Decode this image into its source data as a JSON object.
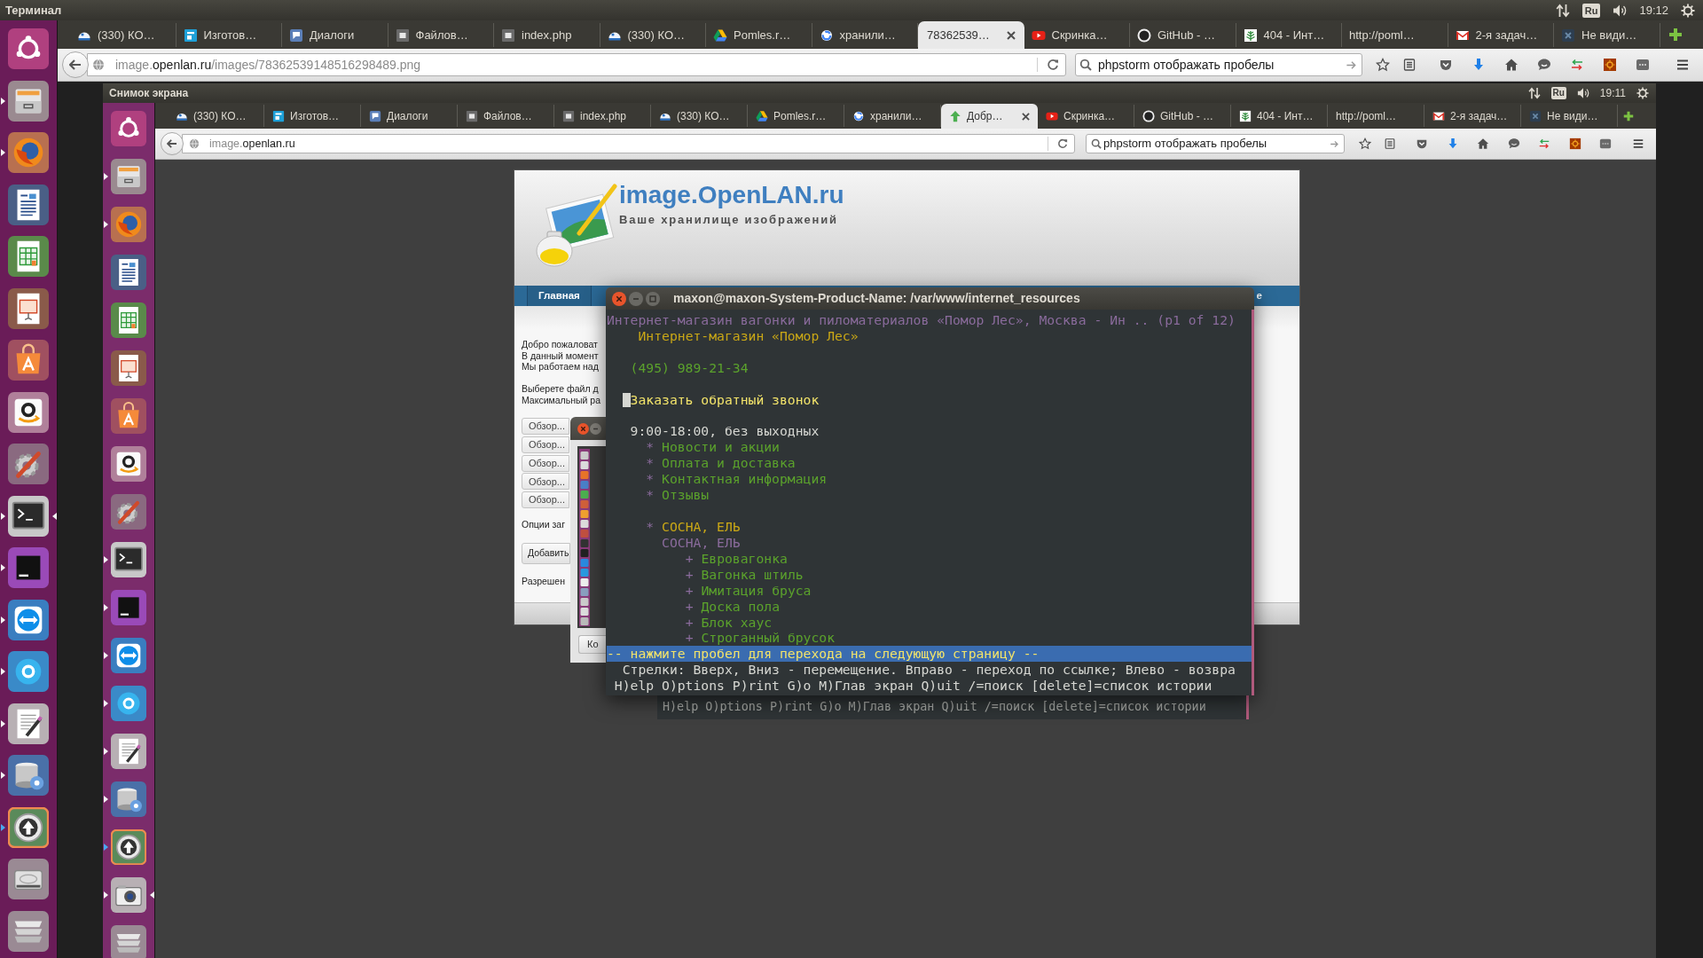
{
  "top_panel": {
    "title": "Терминал",
    "keyboard_layout": "Ru",
    "time": "19:12"
  },
  "launcher": {
    "items": [
      {
        "running": false,
        "focused": false,
        "urgent": false
      },
      {
        "running": true,
        "focused": false,
        "urgent": false
      },
      {
        "running": true,
        "focused": false,
        "urgent": false
      },
      {
        "running": false,
        "focused": false,
        "urgent": false
      },
      {
        "running": false,
        "focused": false,
        "urgent": false
      },
      {
        "running": false,
        "focused": false,
        "urgent": false
      },
      {
        "running": false,
        "focused": false,
        "urgent": false
      },
      {
        "running": false,
        "focused": false,
        "urgent": false
      },
      {
        "running": false,
        "focused": false,
        "urgent": false
      },
      {
        "running": true,
        "focused": true,
        "urgent": false
      },
      {
        "running": true,
        "focused": false,
        "urgent": false
      },
      {
        "running": true,
        "focused": false,
        "urgent": false
      },
      {
        "running": true,
        "focused": false,
        "urgent": false
      },
      {
        "running": true,
        "focused": false,
        "urgent": false
      },
      {
        "running": true,
        "focused": false,
        "urgent": false
      },
      {
        "running": true,
        "focused": false,
        "urgent": true
      },
      {
        "running": false,
        "focused": false,
        "urgent": false
      },
      {
        "running": false,
        "focused": false,
        "urgent": false
      }
    ]
  },
  "browser": {
    "tabs": [
      {
        "title": "(330) КО…",
        "selected": false
      },
      {
        "title": "Изготов…",
        "selected": false
      },
      {
        "title": "Диалоги",
        "selected": false
      },
      {
        "title": "Файлов…",
        "selected": false
      },
      {
        "title": "index.php",
        "selected": false
      },
      {
        "title": "(330) КО…",
        "selected": false
      },
      {
        "title": "Pomles.r…",
        "selected": false
      },
      {
        "title": "хранили…",
        "selected": false
      },
      {
        "title": "78362539…",
        "selected": true
      },
      {
        "title": "Скринка…",
        "selected": false
      },
      {
        "title": "GitHub - …",
        "selected": false
      },
      {
        "title": "404 - Инт…",
        "selected": false
      },
      {
        "title": "http://poml…",
        "selected": false
      },
      {
        "title": "2-я задач…",
        "selected": false
      },
      {
        "title": "Не види…",
        "selected": false
      }
    ],
    "address": {
      "host_start": "image.",
      "domain": "openlan.ru",
      "path": "/images/78362539148516298489.png"
    },
    "search": {
      "value": "phpstorm отображать пробелы"
    }
  },
  "screenshot": {
    "top_panel": {
      "title": "Снимок экрана",
      "keyboard_layout": "Ru",
      "time": "19:11"
    },
    "launcher": {
      "items": [
        {
          "running": false,
          "focused": false,
          "urgent": false
        },
        {
          "running": true,
          "focused": false,
          "urgent": false
        },
        {
          "running": true,
          "focused": false,
          "urgent": false
        },
        {
          "running": false,
          "focused": false,
          "urgent": false
        },
        {
          "running": false,
          "focused": false,
          "urgent": false
        },
        {
          "running": false,
          "focused": false,
          "urgent": false
        },
        {
          "running": false,
          "focused": false,
          "urgent": false
        },
        {
          "running": false,
          "focused": false,
          "urgent": false
        },
        {
          "running": false,
          "focused": false,
          "urgent": false
        },
        {
          "running": true,
          "focused": false,
          "urgent": false
        },
        {
          "running": true,
          "focused": false,
          "urgent": false
        },
        {
          "running": true,
          "focused": false,
          "urgent": false
        },
        {
          "running": true,
          "focused": false,
          "urgent": false
        },
        {
          "running": true,
          "focused": false,
          "urgent": false
        },
        {
          "running": true,
          "focused": false,
          "urgent": false
        },
        {
          "running": true,
          "focused": false,
          "urgent": true
        },
        {
          "running": true,
          "focused": true,
          "urgent": false
        },
        {
          "running": false,
          "focused": false,
          "urgent": false
        }
      ]
    },
    "browser": {
      "tabs": [
        {
          "title": "(330) КО…",
          "selected": false
        },
        {
          "title": "Изготов…",
          "selected": false
        },
        {
          "title": "Диалоги",
          "selected": false
        },
        {
          "title": "Файлов…",
          "selected": false
        },
        {
          "title": "index.php",
          "selected": false
        },
        {
          "title": "(330) КО…",
          "selected": false
        },
        {
          "title": "Pomles.r…",
          "selected": false
        },
        {
          "title": "хранили…",
          "selected": false
        },
        {
          "title": "Добр…",
          "selected": true
        },
        {
          "title": "Скринка…",
          "selected": false
        },
        {
          "title": "GitHub - …",
          "selected": false
        },
        {
          "title": "404 - Инт…",
          "selected": false
        },
        {
          "title": "http://poml…",
          "selected": false
        },
        {
          "title": "2-я задач…",
          "selected": false
        },
        {
          "title": "Не види…",
          "selected": false
        }
      ],
      "address": {
        "host_start": "image.",
        "domain": "openlan.ru"
      },
      "search": {
        "value": "phpstorm отображать пробелы"
      }
    },
    "web_page": {
      "site_title": "image.OpenLAN.ru",
      "tagline": "Ваше хранилище изображений",
      "nav": [
        "Главная",
        "е"
      ],
      "intro_lines": [
        "Добро пожаловат",
        "В данный момент",
        "Мы работаем над"
      ],
      "upload_lines": [
        "Выберете файл д",
        "Максимальный ра"
      ],
      "browse_buttons": [
        "Обзор...",
        "Обзор...",
        "Обзор...",
        "Обзор...",
        "Обзор..."
      ],
      "options_label": "Опции заг",
      "add_button": "Добавить",
      "rules_label": "Разрешен"
    },
    "dialog": {
      "button": "Ко"
    },
    "terminal_line": "H)elp O)ptions P)rint G)o M)Глав экран Q)uit /=поиск [delete]=список истории"
  },
  "terminal": {
    "title": "maxon@maxon-System-Product-Name: /var/www/internet_resources",
    "lines": [
      {
        "kind": "title",
        "text": "Интернет-магазин вагонки и пиломатериалов «Помор Лес», Москва - Ин .. (p1 of 12)"
      },
      {
        "kind": "heading",
        "text": "Интернет-магазин «Помор Лес»"
      },
      {
        "kind": "blank"
      },
      {
        "kind": "phone",
        "text": "(495) 989-21-34"
      },
      {
        "kind": "blank"
      },
      {
        "kind": "current_link",
        "text": "Заказать обратный звонок"
      },
      {
        "kind": "blank"
      },
      {
        "kind": "text",
        "text": "9:00-18:00, без выходных"
      },
      {
        "kind": "menu_link",
        "bullet": "*",
        "text": "Новости и акции"
      },
      {
        "kind": "menu_link",
        "bullet": "*",
        "text": "Оплата и доставка"
      },
      {
        "kind": "menu_link",
        "bullet": "*",
        "text": "Контактная информация"
      },
      {
        "kind": "menu_link",
        "bullet": "*",
        "text": "Отзывы"
      },
      {
        "kind": "blank"
      },
      {
        "kind": "category_link",
        "bullet": "*",
        "text": "СОСНА, ЕЛЬ"
      },
      {
        "kind": "category_heading",
        "text": "СОСНА, ЕЛЬ"
      },
      {
        "kind": "sub_link",
        "bullet": "+",
        "text": "Евровагонка"
      },
      {
        "kind": "sub_link",
        "bullet": "+",
        "text": "Вагонка штиль"
      },
      {
        "kind": "sub_link",
        "bullet": "+",
        "text": "Имитация бруса"
      },
      {
        "kind": "sub_link",
        "bullet": "+",
        "text": "Доска пола"
      },
      {
        "kind": "sub_link",
        "bullet": "+",
        "text": "Блок хаус"
      },
      {
        "kind": "sub_link",
        "bullet": "+",
        "text": "Строганный брусок"
      },
      {
        "kind": "status",
        "text": "-- нажмите пробел для перехода на следующую страницу --"
      },
      {
        "kind": "help",
        "text": "Стрелки: Вверх, Вниз - перемещение. Вправо - переход по ссылке; Влево - возвра"
      },
      {
        "kind": "keys",
        "text": "H)elp O)ptions P)rint G)o M)Глав экран Q)uit /=поиск [delete]=список истории"
      }
    ]
  }
}
